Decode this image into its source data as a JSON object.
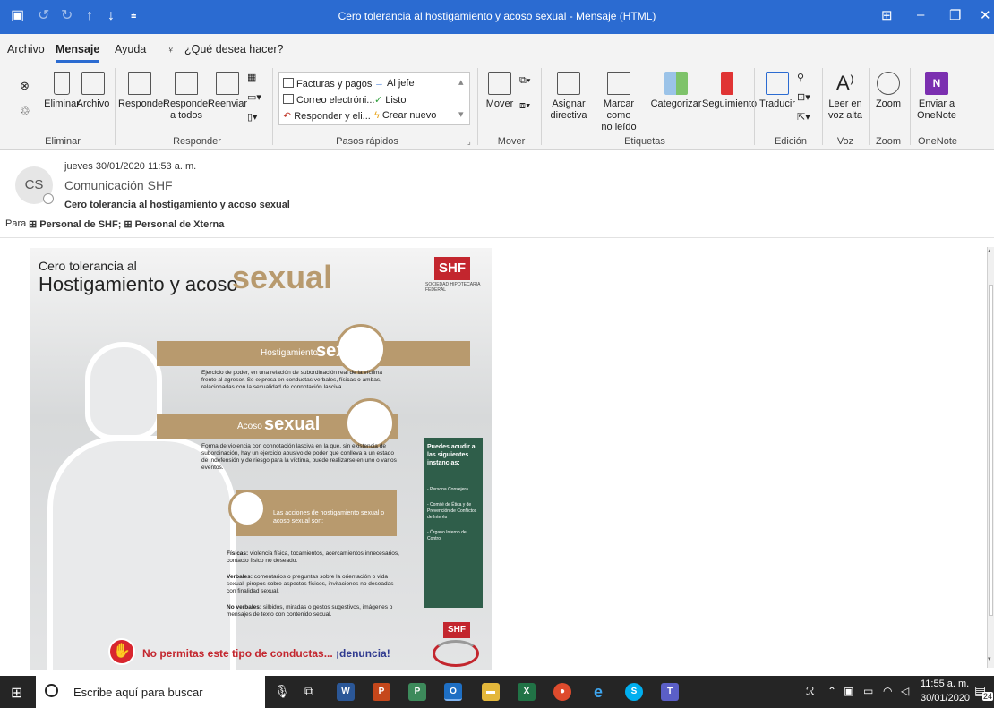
{
  "window": {
    "title": "Cero tolerancia al hostigamiento y acoso sexual - Mensaje (HTML)",
    "accent": "#2b6bd1"
  },
  "menu": {
    "tabs": [
      "Archivo",
      "Mensaje",
      "Ayuda"
    ],
    "tell_me": "¿Qué desea hacer?"
  },
  "ribbon": {
    "eliminar": {
      "delete": "Eliminar",
      "archive": "Archivo",
      "group": "Eliminar"
    },
    "responder": {
      "reply": "Responder",
      "reply_all_1": "Responder",
      "reply_all_2": "a todos",
      "forward": "Reenviar",
      "group": "Responder"
    },
    "pasos": {
      "items": [
        "Facturas y pagos",
        "Correo electróni...",
        "Responder y eli...",
        "Al jefe",
        "Listo",
        "Crear nuevo"
      ],
      "group": "Pasos rápidos"
    },
    "mover": {
      "move": "Mover",
      "group": "Mover"
    },
    "etiquetas": {
      "assign_1": "Asignar",
      "assign_2": "directiva",
      "mark_1": "Marcar como",
      "mark_2": "no leído",
      "categorize": "Categorizar",
      "followup": "Seguimiento",
      "group": "Etiquetas"
    },
    "edicion": {
      "translate": "Traducir",
      "group": "Edición"
    },
    "voz": {
      "read_1": "Leer en",
      "read_2": "voz alta",
      "group": "Voz"
    },
    "zoom": {
      "zoom": "Zoom",
      "group": "Zoom"
    },
    "onenote": {
      "send_1": "Enviar a",
      "send_2": "OneNote",
      "group": "OneNote"
    }
  },
  "message": {
    "avatar": "CS",
    "date": "jueves 30/01/2020 11:53 a. m.",
    "sender": "Comunicación SHF",
    "subject": "Cero tolerancia al hostigamiento y acoso sexual",
    "to_label": "Para",
    "recipients": "⊞ Personal de SHF;  ⊞ Personal de Xterna"
  },
  "poster": {
    "title_line1": "Cero tolerancia al",
    "title_line2": "Hostigamiento y acoso",
    "title_word": "sexual",
    "logo": "SHF",
    "logo_sub": "SOCIEDAD HIPOTECARIA FEDERAL",
    "section1_a": "Hostigamiento",
    "section1_b": "sexual",
    "section1_text": "Ejercicio de poder, en una relación de subordinación real de la víctima frente al agresor. Se expresa en conductas verbales, físicas o ambas, relacionadas con la sexualidad de connotación lasciva.",
    "section2_a": "Acoso",
    "section2_b": "sexual",
    "section2_text": "Forma de violencia con connotación lasciva en la que, sin existencia de subordinación, hay un ejercicio abusivo de poder que conlleva a un estado de indefensión y de riesgo para la víctima, puede realizarse en uno o varios eventos.",
    "section3_title": "Las acciones de hostigamiento sexual o acoso sexual son:",
    "fisicas_label": "Físicas:",
    "fisicas_text": "violencia física, tocamientos, acercamientos innecesarios, contacto físico no deseado.",
    "verbales_label": "Verbales:",
    "verbales_text": "comentarios o preguntas sobre la orientación o vida sexual, piropos sobre aspectos físicos, invitaciones no deseadas con finalidad sexual.",
    "noverbales_label": "No verbales:",
    "noverbales_text": "silbidos, miradas o gestos sugestivos, imágenes o mensajes de texto con contenido sexual.",
    "box_title": "Puedes acudir a las siguientes instancias:",
    "box_items": [
      "- Persona Consejera",
      "- Comité de Ética y de Prevención de Conflictos de Interés",
      "- Órgano Interno de Control"
    ],
    "footer": "No permitas este tipo de conductas...",
    "footer_b": "¡denuncia!",
    "tan": "#b89a6e",
    "green": "#2f5e4a"
  },
  "taskbar": {
    "search": "Escribe aquí para buscar",
    "time": "11:55 a. m.",
    "date": "30/01/2020",
    "badge": "24"
  }
}
